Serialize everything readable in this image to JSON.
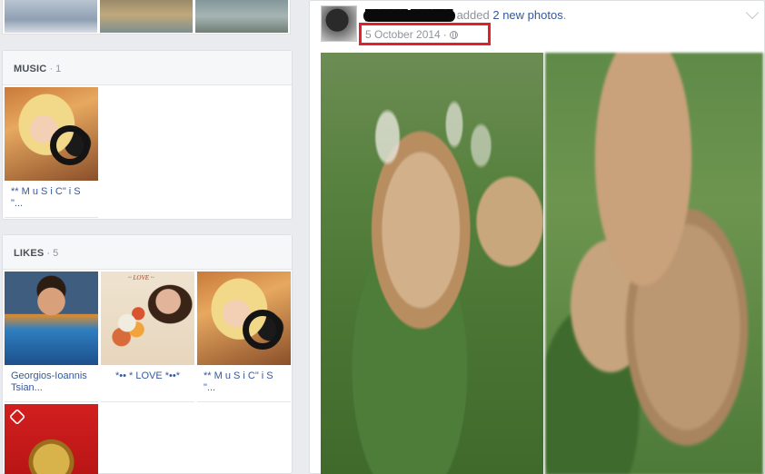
{
  "music": {
    "title": "MUSIC",
    "count": "1",
    "items": [
      {
        "label": "** M u S i C\" i S \"..."
      }
    ]
  },
  "likes": {
    "title": "LIKES",
    "count": "5",
    "items": [
      {
        "label": "Georgios-Ioannis Tsian..."
      },
      {
        "label": "*•• * LOVE *••*"
      },
      {
        "label": "** M u S i C\" i S \"..."
      },
      {
        "label": ""
      }
    ]
  },
  "post": {
    "author": "██████ ██████",
    "action_prefix": "added",
    "action_link": "2 new photos",
    "action_suffix": ".",
    "date": "5 October 2014",
    "privacy_icon": "globe-icon",
    "highlight_color": "#e0212b"
  },
  "theme": {
    "link_color": "#365899",
    "muted_color": "#90949c",
    "background": "#e9ebee"
  }
}
